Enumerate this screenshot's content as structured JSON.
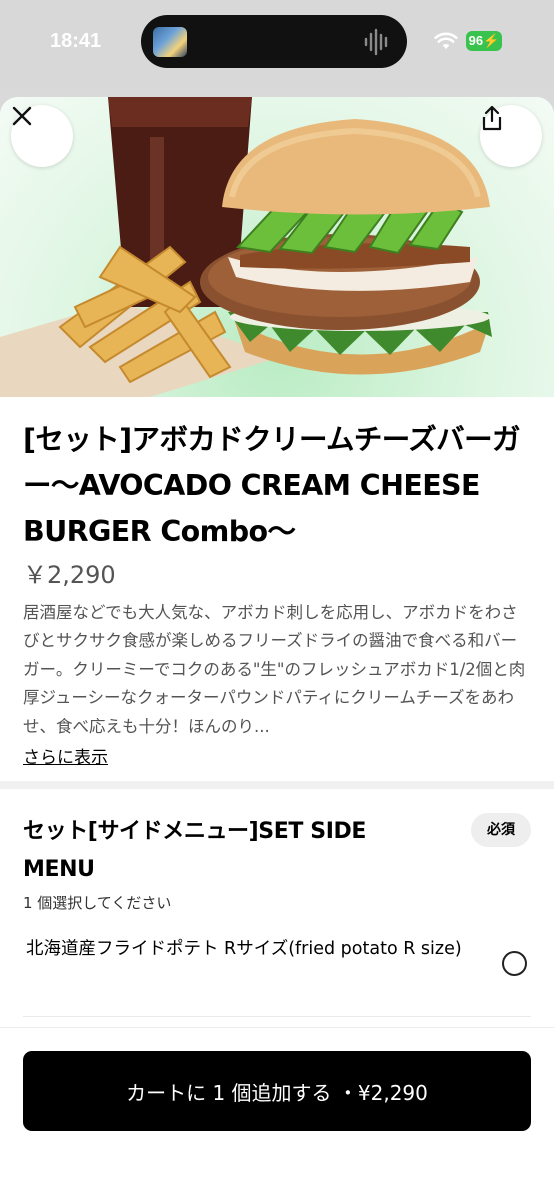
{
  "status_bar": {
    "time": "18:41",
    "battery": "96",
    "icons": [
      "media-thumbnail-icon",
      "audio-waveform-icon",
      "wifi-icon",
      "battery-charging-icon"
    ]
  },
  "header": {
    "close_icon": "close-icon",
    "share_icon": "share-icon"
  },
  "product": {
    "title": "[セット]アボカドクリームチーズバーガー〜AVOCADO CREAM CHEESE BURGER Combo〜",
    "price": "￥2,290",
    "description": "居酒屋などでも大人気な、アボカド刺しを応用し、アボカドをわさびとサクサク食感が楽しめるフリーズドライの醤油で食べる和バーガー。クリーミーでコクのある\"生\"のフレッシュアボカド1/2個と肉厚ジューシーなクォーターパウンドパティにクリームチーズをあわせ、食べ応えも十分！ほんのり...",
    "more_label": "さらに表示"
  },
  "section": {
    "title": "セット[サイドメニュー]SET SIDE MENU",
    "required_badge": "必須",
    "subtitle": "1 個選択してください",
    "options": [
      {
        "label": "北海道産フライドポテト Rサイズ(fried potato R size)",
        "selected": false
      }
    ]
  },
  "footer": {
    "cart_button_label": "カートに 1 個追加する ・¥2,290"
  },
  "colors": {
    "accent_button": "#000000",
    "battery": "#39c24d",
    "hero_background": "#dff6e3"
  }
}
